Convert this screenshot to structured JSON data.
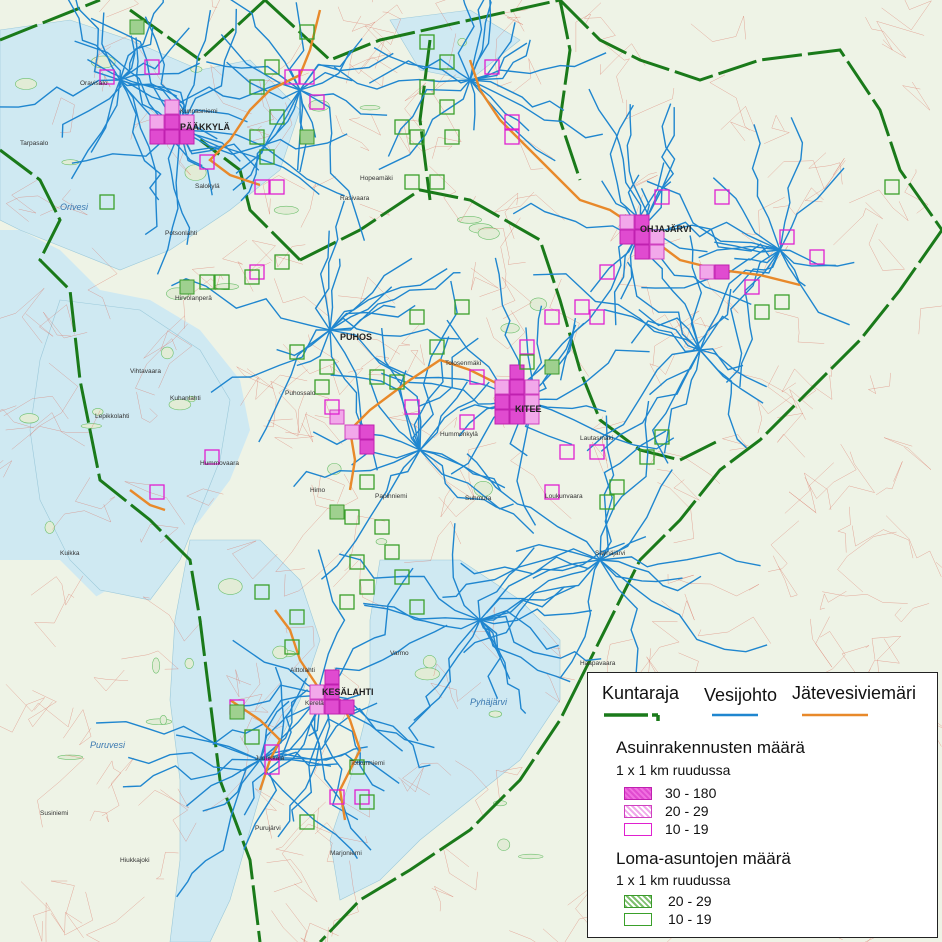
{
  "map": {
    "water_names": [
      {
        "name": "Orivesi",
        "kind": "lake"
      },
      {
        "name": "Puruvesi",
        "kind": "lake"
      },
      {
        "name": "Pyhäjärvi",
        "kind": "lake"
      }
    ],
    "town_names": [
      {
        "name": "KITEE",
        "kind": "town"
      },
      {
        "name": "PÄÄKKYLÄ",
        "kind": "village"
      },
      {
        "name": "PUHOS",
        "kind": "village"
      },
      {
        "name": "KESÄLAHTI",
        "kind": "village"
      },
      {
        "name": "OHJAJÄRVI",
        "kind": "village"
      }
    ],
    "place_names": [
      "Oravisalo",
      "Tarpasalo",
      "Kunnasniemi",
      "Salokylä",
      "Rasivaara",
      "Hopeamäki",
      "Purujärvi",
      "Hummovaara",
      "Tolosenmäki",
      "Puhossalo",
      "Juurikkala",
      "Totkunniemi",
      "Kuhanlahti",
      "Vihtavaara",
      "Kerelä",
      "Himo",
      "Papinniemi",
      "Haapavaara",
      "Hirvolanperä",
      "Potsonlahti",
      "Hummonkylä",
      "Loukunvaara",
      "Lautasmäki",
      "Lepikkolahti",
      "Säynäjärvi",
      "Suhmura",
      "Kuikka",
      "Varmo",
      "Marjoniemi",
      "Aittolahti",
      "Hiukkajoki",
      "Susiniemi",
      "Puhossalo",
      "Kerelä"
    ],
    "colors": {
      "water": "#cfe9f2",
      "land": "#eef3e6",
      "road": "#d96a5a",
      "boundary": "#1a7a1a",
      "water_main": "#1f86cf",
      "sewer": "#e8892a",
      "res_hi": "#e04bd0",
      "res_lo": "#e020d0",
      "holiday": "#3aa02a"
    }
  },
  "legend": {
    "boundary_label": "Kuntaraja",
    "water_label": "Vesijohto",
    "sewer_label": "Jätevesiviemäri",
    "residential_title": "Asuinrakennusten määrä",
    "residential_subtitle": "1 x 1 km ruudussa",
    "residential_classes": [
      {
        "range": "30  -  180",
        "icon": "pink-dense-hatch"
      },
      {
        "range": "20  -    29",
        "icon": "pink-light-hatch"
      },
      {
        "range": "10  -    19",
        "icon": "pink-outline"
      }
    ],
    "holiday_title": "Loma-asuntojen määrä",
    "holiday_subtitle": "1 x 1 km ruudussa",
    "holiday_classes": [
      {
        "range": "20  -  29",
        "icon": "green-hatch"
      },
      {
        "range": "10  -  19",
        "icon": "green-outline"
      }
    ]
  }
}
